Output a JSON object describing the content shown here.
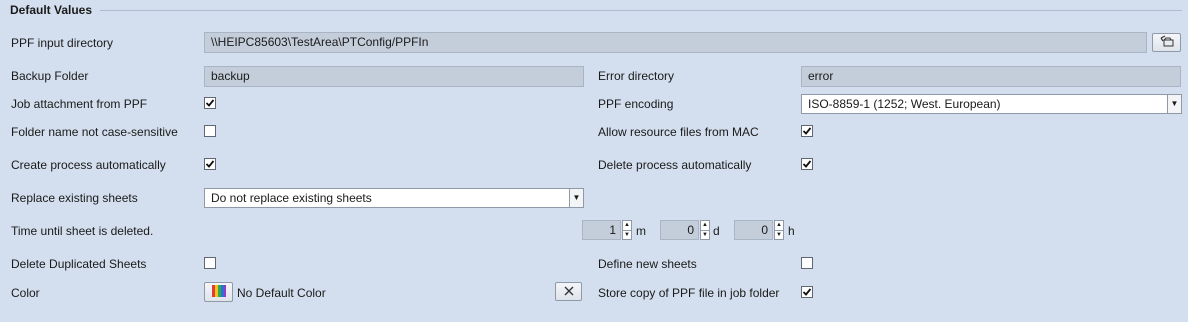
{
  "section": {
    "title": "Default Values"
  },
  "ppf_input": {
    "label": "PPF input directory",
    "value": "\\\\HEIPC85603\\TestArea\\PTConfig/PPFIn"
  },
  "backup": {
    "label": "Backup Folder",
    "value": "backup"
  },
  "error_dir": {
    "label": "Error directory",
    "value": "error"
  },
  "job_attachment": {
    "label": "Job attachment from PPF",
    "checked": true
  },
  "ppf_encoding": {
    "label": "PPF encoding",
    "value": "ISO-8859-1 (1252; West. European)"
  },
  "folder_case": {
    "label": "Folder name not case-sensitive",
    "checked": false
  },
  "allow_mac": {
    "label": "Allow resource files from MAC",
    "checked": true
  },
  "create_process": {
    "label": "Create process automatically",
    "checked": true
  },
  "delete_process": {
    "label": "Delete process automatically",
    "checked": true
  },
  "replace_sheets": {
    "label": "Replace existing sheets",
    "value": "Do not replace existing sheets"
  },
  "time_until_delete": {
    "label": "Time until sheet is deleted.",
    "months": "1",
    "months_unit": "m",
    "days": "0",
    "days_unit": "d",
    "hours": "0",
    "hours_unit": "h"
  },
  "delete_duplicated": {
    "label": "Delete Duplicated Sheets",
    "checked": false
  },
  "define_new_sheets": {
    "label": "Define new sheets",
    "checked": false
  },
  "color": {
    "label": "Color",
    "value": "No Default Color"
  },
  "store_copy": {
    "label": "Store copy of PPF file in job folder",
    "checked": true
  },
  "colors": {
    "background": "#d3dfee",
    "field": "#c4ceda"
  }
}
